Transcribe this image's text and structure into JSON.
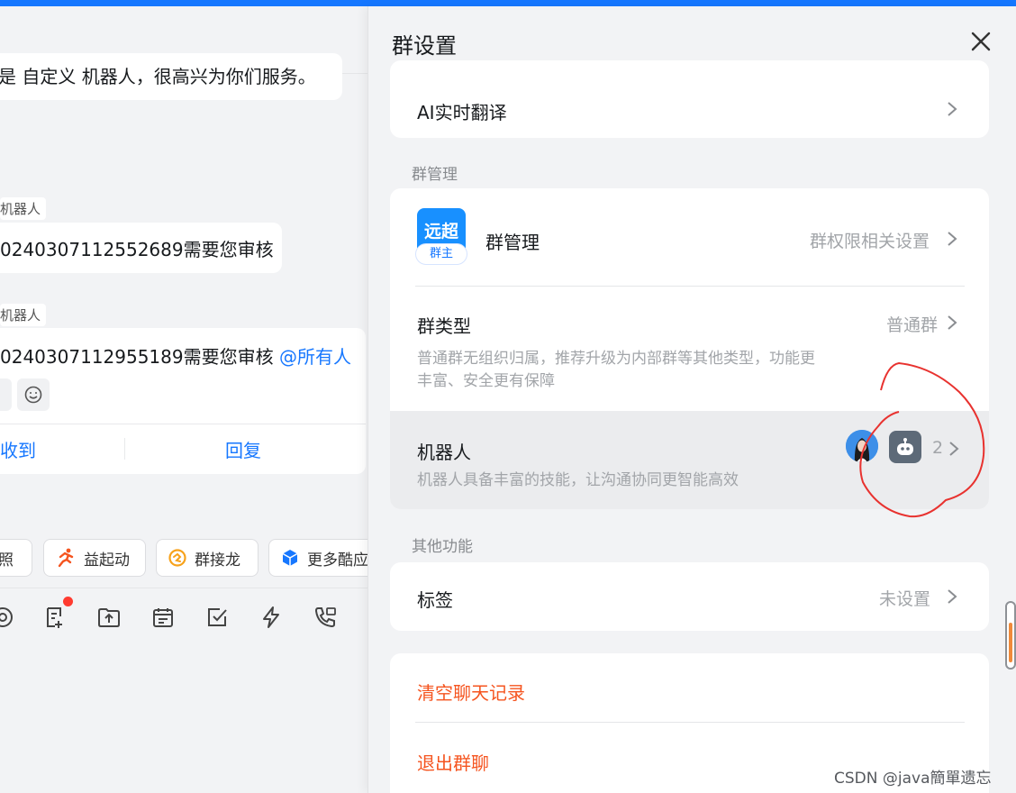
{
  "chat": {
    "message1": "是 自定义 机器人，很高兴为你们服务。",
    "sender_tag1": "机器人",
    "message2": "0240307112552689需要您审核",
    "sender_tag2": "机器人",
    "card": {
      "text": "0240307112955189需要您审核 ",
      "mention": "@所有人",
      "received": "收到",
      "reply": "回复"
    },
    "quick_actions": [
      "拍照",
      "益起动",
      "群接龙",
      "更多酷应"
    ],
    "toolbar_icons": [
      "at-icon",
      "note-icon",
      "upload-icon",
      "calendar-icon",
      "check-icon",
      "bolt-icon",
      "phone-icon"
    ]
  },
  "panel": {
    "title": "群设置",
    "ai_translate": "AI实时翻译",
    "section_group_label": "群管理",
    "group_manage": {
      "title": "群管理",
      "value": "群权限相关设置",
      "logo_text": "远超",
      "logo_badge": "群主"
    },
    "group_type": {
      "title": "群类型",
      "value": "普通群",
      "desc_line1": "普通群无组织归属，推荐升级为内部群等其他类型，功能更",
      "desc_line2": "丰富、安全更有保障"
    },
    "robot": {
      "title": "机器人",
      "desc": "机器人具备丰富的技能，让沟通协同更智能高效",
      "count": "2"
    },
    "section_other_label": "其他功能",
    "tags": {
      "title": "标签",
      "value": "未设置"
    },
    "clear_history": "清空聊天记录",
    "leave_group": "退出群聊"
  },
  "colors": {
    "accent": "#1677ff",
    "danger": "#f5541f",
    "annotation": "#e8322f"
  },
  "watermark": "CSDN @java簡單遗忘"
}
